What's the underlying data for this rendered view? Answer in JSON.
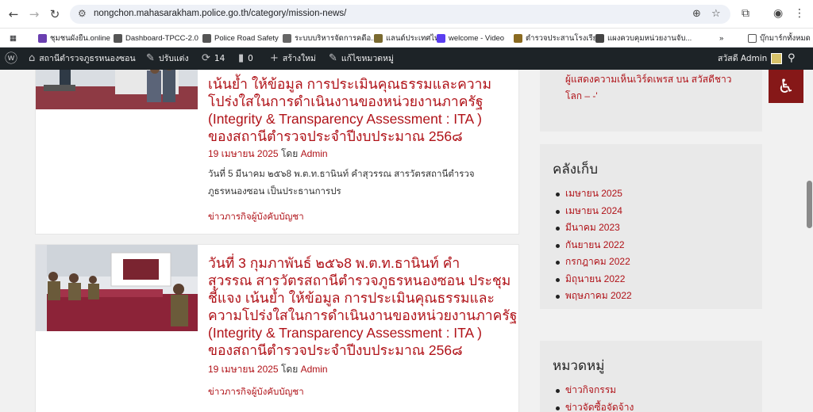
{
  "browser": {
    "url": "nongchon.mahasarakham.police.go.th/category/mission-news/"
  },
  "bookmarks": [
    {
      "label": "ชุมชนผังยืน.online",
      "color": "#6a3fb0"
    },
    {
      "label": "Dashboard-TPCC-2.0",
      "color": "#555555"
    },
    {
      "label": "Police Road Safety",
      "color": "#555555"
    },
    {
      "label": "ระบบบริหารจัดการคดีอ...",
      "color": "#666666"
    },
    {
      "label": "แลนด์ประเทศไทย",
      "color": "#7a6a30"
    },
    {
      "label": "welcome - Video",
      "color": "#5a3df0"
    },
    {
      "label": "ตำรวจประสานโรงเรียน",
      "color": "#8a6a20"
    },
    {
      "label": "แผงควบคุมหน่วยงานจับ...",
      "color": "#444444"
    },
    {
      "label": "บุ๊กมาร์กทั้งหมด",
      "color": "#555555"
    }
  ],
  "wpbar": {
    "site_name": "สถานีตำรวจภูธรหนองซอน",
    "customize": "ปรับแต่ง",
    "updates": "14",
    "comments": "0",
    "new": "สร้างใหม่",
    "edit": "แก้ไขหมวดหมู่",
    "greeting": "สวัสดี Admin"
  },
  "posts": [
    {
      "title_lines": [
        "เน้นย้ำ ให้ข้อมูล การประเมินคุณธรรมและความ",
        "โปร่งใสในการดำเนินงานของหน่วยงานภาครัฐ",
        "(Integrity & Transparency Assessment : ITA )",
        "  ของสถานีตำรวจประจำปีงบประมาณ 256๘"
      ],
      "date": "19 เมษายน 2025",
      "by": "โดย",
      "author": "Admin",
      "excerpt_lines": [
        "วันที่ 5 มีนาคม  ๒๕๖8 พ.ต.ท.ธานินท์  คำสุวรรณ สารวัตรสถานีตำรวจ",
        "ภูธรหนองซอน เป็นประธานการปร"
      ],
      "category": "ข่าวภารกิจผู้บังคับบัญชา"
    },
    {
      "title_lines": [
        "วันที่ 3 กุมภาพันธ์  ๒๕๖8 พ.ต.ท.ธานินท์  คำ",
        "สุวรรณ สารวัตรสถานีตำรวจภูธรหนองซอน ประชุม",
        "ชี้แจง เน้นย้ำ ให้ข้อมูล การประเมินคุณธรรมและ",
        "ความโปร่งใสในการดำเนินงานของหน่วยงานภาครัฐ",
        "(Integrity & Transparency Assessment : ITA )",
        "  ของสถานีตำรวจประจำปีงบประมาณ 256๘"
      ],
      "date": "19 เมษายน 2025",
      "by": "โดย",
      "author": "Admin",
      "category": "ข่าวภารกิจผู้บังคับบัญชา"
    }
  ],
  "sidebar": {
    "recent_comment_line1": "ผู้แสดงความเห็นเวิร์ดเพรส บน สวัสดีชาว",
    "recent_comment_line2": "โลก – -'",
    "archives_title": "คลังเก็บ",
    "archives": [
      "เมษายน 2025",
      "เมษายน 2024",
      "มีนาคม 2023",
      "กันยายน 2022",
      "กรกฎาคม 2022",
      "มิถุนายน 2022",
      "พฤษภาคม 2022"
    ],
    "categories_title": "หมวดหมู่",
    "categories": [
      "ข่าวกิจกรรม",
      "ข่าวจัดซื้อจัดจ้าง"
    ]
  }
}
